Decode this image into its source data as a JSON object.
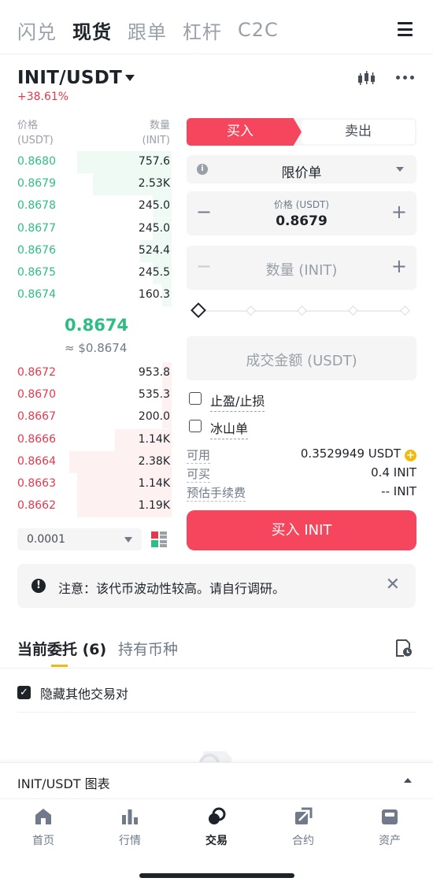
{
  "top_tabs": [
    "闪兑",
    "现货",
    "跟单",
    "杠杆",
    "C2C"
  ],
  "active_top_tab": 1,
  "pair": {
    "symbol": "INIT/USDT",
    "change": "+38.61%"
  },
  "orderbook": {
    "price_header": [
      "价格",
      "(USDT)"
    ],
    "qty_header": [
      "数量",
      "(INIT)"
    ],
    "bids": [
      {
        "price": "0.8680",
        "qty": "757.6",
        "depth": 0.6
      },
      {
        "price": "0.8679",
        "qty": "2.53K",
        "depth": 0.5
      },
      {
        "price": "0.8678",
        "qty": "245.0",
        "depth": 0.12
      },
      {
        "price": "0.8677",
        "qty": "245.0",
        "depth": 0.12
      },
      {
        "price": "0.8676",
        "qty": "524.4",
        "depth": 0.2
      },
      {
        "price": "0.8675",
        "qty": "245.5",
        "depth": 0.12
      },
      {
        "price": "0.8674",
        "qty": "160.3",
        "depth": 0.06
      }
    ],
    "mid_price": "0.8674",
    "mid_usd": "≈ $0.8674",
    "asks": [
      {
        "price": "0.8672",
        "qty": "953.8",
        "depth": 0.06
      },
      {
        "price": "0.8670",
        "qty": "535.3",
        "depth": 0.06
      },
      {
        "price": "0.8667",
        "qty": "200.0",
        "depth": 0.06
      },
      {
        "price": "0.8666",
        "qty": "1.14K",
        "depth": 0.36
      },
      {
        "price": "0.8664",
        "qty": "2.38K",
        "depth": 0.65
      },
      {
        "price": "0.8663",
        "qty": "1.14K",
        "depth": 0.6
      },
      {
        "price": "0.8662",
        "qty": "1.19K",
        "depth": 0.6
      }
    ],
    "step": "0.0001"
  },
  "form": {
    "buy_label": "买入",
    "sell_label": "卖出",
    "order_type": "限价单",
    "price_label": "价格 (USDT)",
    "price_value": "0.8679",
    "qty_placeholder": "数量 (INIT)",
    "total_placeholder": "成交金额 (USDT)",
    "tpsl_label": "止盈/止损",
    "iceberg_label": "冰山单",
    "available_label": "可用",
    "available_value": "0.3529949 USDT",
    "can_buy_label": "可买",
    "can_buy_value": "0.4 INIT",
    "fee_label": "预估手续费",
    "fee_value": "-- INIT",
    "submit_label": "买入 INIT",
    "slider_percent": 0
  },
  "notice": "注意：该代币波动性较高。请自行调研。",
  "orders": {
    "tab_open": "当前委托 (6)",
    "tab_holdings": "持有币种",
    "hide_other_label": "隐藏其他交易对"
  },
  "chart_bar": "INIT/USDT 图表",
  "bottom_nav": [
    "首页",
    "行情",
    "交易",
    "合约",
    "资产"
  ],
  "active_nav": 2,
  "colors": {
    "green": "#2ebd85",
    "red": "#f6465d",
    "accent": "#f0b90b",
    "text": "#1e2329"
  }
}
